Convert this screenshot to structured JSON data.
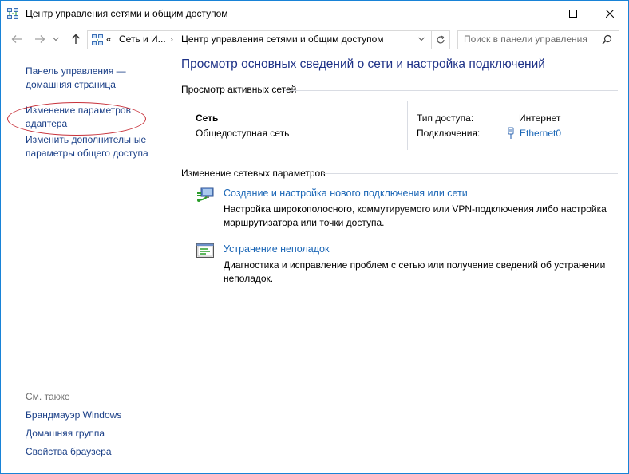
{
  "window": {
    "title": "Центр управления сетями и общим доступом",
    "icon": "network-center-icon",
    "controls": {
      "minimize": "minimize-icon",
      "maximize": "maximize-icon",
      "close": "close-icon"
    }
  },
  "address_bar": {
    "overflow": "«",
    "crumbs": [
      "Сеть и И...",
      "Центр управления сетями и общим доступом"
    ],
    "search_placeholder": "Поиск в панели управления"
  },
  "left_pane": {
    "links": [
      {
        "line1": "Панель управления —",
        "line2": "домашняя страница"
      },
      {
        "line1": "Изменение параметров",
        "line2": "адаптера"
      },
      {
        "line1": "Изменить дополнительные",
        "line2": "параметры общего доступа"
      }
    ],
    "see_also_title": "См. также",
    "see_also": [
      "Брандмауэр Windows",
      "Домашняя группа",
      "Свойства браузера"
    ],
    "highlight_color": "#c7313a"
  },
  "main": {
    "heading": "Просмотр основных сведений о сети и настройка подключений",
    "active_networks": {
      "title": "Просмотр активных сетей",
      "network_name": "Сеть",
      "network_type": "Общедоступная сеть",
      "access_label": "Тип доступа:",
      "access_value": "Интернет",
      "connections_label": "Подключения:",
      "connections_value": "Ethernet0"
    },
    "change_settings": {
      "title": "Изменение сетевых параметров",
      "items": [
        {
          "icon": "new-connection-icon",
          "link": "Создание и настройка нового подключения или сети",
          "desc1": "Настройка широкополосного, коммутируемого или VPN-подключения либо настройка",
          "desc2": "маршрутизатора или точки доступа."
        },
        {
          "icon": "troubleshoot-icon",
          "link": "Устранение неполадок",
          "desc1": "Диагностика и исправление проблем с сетью или получение сведений об устранении",
          "desc2": "неполадок."
        }
      ]
    }
  }
}
